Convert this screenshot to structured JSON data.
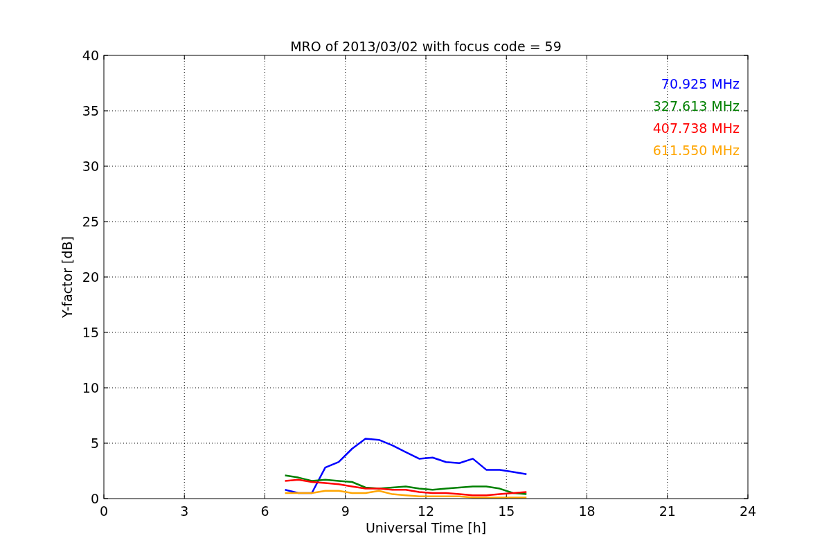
{
  "figure": {
    "chart_data": {
      "type": "line",
      "title": "MRO of 2013/03/02 with focus code = 59",
      "xlabel": "Universal Time [h]",
      "ylabel": "Y-factor [dB]",
      "x": [
        6.75,
        7.25,
        7.75,
        8.25,
        8.75,
        9.25,
        9.75,
        10.25,
        10.75,
        11.25,
        11.75,
        12.25,
        12.75,
        13.25,
        13.75,
        14.25,
        14.75,
        15.25,
        15.75
      ],
      "series": [
        {
          "name": "70.925 MHz",
          "color": "#0000ff",
          "values": [
            0.8,
            0.5,
            0.5,
            2.8,
            3.3,
            4.5,
            5.4,
            5.3,
            4.8,
            4.2,
            3.6,
            3.7,
            3.3,
            3.2,
            3.6,
            2.6,
            2.6,
            2.4,
            2.2
          ]
        },
        {
          "name": "327.613 MHz",
          "color": "#008000",
          "values": [
            2.1,
            1.9,
            1.6,
            1.7,
            1.6,
            1.5,
            1.0,
            0.9,
            1.0,
            1.1,
            0.9,
            0.8,
            0.9,
            1.0,
            1.1,
            1.1,
            0.9,
            0.5,
            0.4
          ]
        },
        {
          "name": "407.738 MHz",
          "color": "#ff0000",
          "values": [
            1.6,
            1.7,
            1.5,
            1.4,
            1.3,
            1.1,
            0.9,
            0.9,
            0.8,
            0.8,
            0.6,
            0.5,
            0.5,
            0.4,
            0.3,
            0.3,
            0.4,
            0.5,
            0.6
          ]
        },
        {
          "name": "611.550 MHz",
          "color": "#ffa500",
          "values": [
            0.5,
            0.5,
            0.5,
            0.7,
            0.7,
            0.5,
            0.5,
            0.7,
            0.4,
            0.3,
            0.2,
            0.2,
            0.2,
            0.2,
            0.1,
            0.1,
            0.1,
            0.1,
            0.1
          ]
        }
      ],
      "grid": true,
      "xlim": [
        0,
        24
      ],
      "ylim": [
        0,
        40
      ],
      "xticks": [
        0,
        3,
        6,
        9,
        12,
        15,
        18,
        21,
        24
      ],
      "yticks": [
        0,
        5,
        10,
        15,
        20,
        25,
        30,
        35,
        40
      ]
    }
  }
}
